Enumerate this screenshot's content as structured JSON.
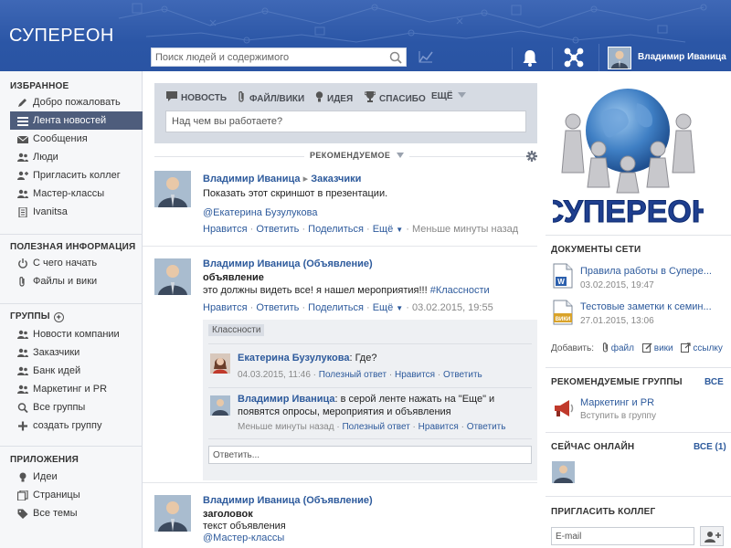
{
  "header": {
    "logo": "СУПЕРЕОН",
    "search_placeholder": "Поиск людей и содержимого",
    "user_name": "Владимир Иваница"
  },
  "sidebar": {
    "favorites_title": "ИЗБРАННОЕ",
    "favorites": [
      {
        "label": "Добро пожаловать",
        "icon": "pencil-icon"
      },
      {
        "label": "Лента новостей",
        "icon": "list-icon",
        "active": true
      },
      {
        "label": "Сообщения",
        "icon": "envelope-icon"
      },
      {
        "label": "Люди",
        "icon": "people-icon"
      },
      {
        "label": "Пригласить коллег",
        "icon": "add-user-icon"
      },
      {
        "label": "Мастер-классы",
        "icon": "people-icon"
      },
      {
        "label": "Ivanitsa",
        "icon": "page-icon"
      }
    ],
    "useful_title": "ПОЛЕЗНАЯ ИНФОРМАЦИЯ",
    "useful": [
      {
        "label": "С чего начать",
        "icon": "power-icon"
      },
      {
        "label": "Файлы и вики",
        "icon": "paperclip-icon"
      }
    ],
    "groups_title": "ГРУППЫ",
    "groups": [
      {
        "label": "Новости компании",
        "icon": "people-icon"
      },
      {
        "label": "Заказчики",
        "icon": "people-icon"
      },
      {
        "label": "Банк идей",
        "icon": "people-icon"
      },
      {
        "label": "Маркетинг и PR",
        "icon": "people-icon"
      },
      {
        "label": "Все группы",
        "icon": "search-icon"
      },
      {
        "label": "создать группу",
        "icon": "plus-icon"
      }
    ],
    "apps_title": "ПРИЛОЖЕНИЯ",
    "apps": [
      {
        "label": "Идеи",
        "icon": "bulb-icon"
      },
      {
        "label": "Страницы",
        "icon": "pages-icon"
      },
      {
        "label": "Все темы",
        "icon": "tag-icon"
      }
    ]
  },
  "composer": {
    "tabs": [
      "НОВОСТЬ",
      "ФАЙЛ/ВИКИ",
      "ИДЕЯ",
      "СПАСИБО",
      "ЕЩЁ"
    ],
    "placeholder": "Над чем вы работаете?"
  },
  "feed": {
    "filter_label": "РЕКОМЕНДУЕМОЕ",
    "post1": {
      "author": "Владимир Иваница",
      "target": "Заказчики",
      "text": "Показать этот скриншот в презентации.",
      "mention": "@Екатерина Бузулукова",
      "like": "Нравится",
      "reply": "Ответить",
      "share": "Поделиться",
      "more": "Ещё",
      "time": "Меньше минуты назад"
    },
    "post2": {
      "author": "Владимир Иваница (Объявление)",
      "title": "объявление",
      "text": "это должны видеть все! я нашел мероприятия!!! ",
      "hashtag": "#Классности",
      "like": "Нравится",
      "reply": "Ответить",
      "share": "Поделиться",
      "more": "Ещё",
      "time": "03.02.2015, 19:55",
      "topic_tag": "Классности",
      "comments": [
        {
          "author": "Екатерина Бузулукова",
          "text": "Где?",
          "time": "04.03.2015, 11:46",
          "useful": "Полезный ответ",
          "like": "Нравится",
          "reply": "Ответить"
        },
        {
          "author": "Владимир Иваница",
          "text": "в серой ленте нажать на \"Еще\" и",
          "text2": "появятся опросы, мероприятия и объявления",
          "time": "Меньше минуты назад",
          "useful": "Полезный ответ",
          "like": "Нравится",
          "reply": "Ответить"
        }
      ],
      "reply_placeholder": "Ответить..."
    },
    "post3": {
      "author": "Владимир Иваница (Объявление)",
      "title": "заголовок",
      "text": "текст объявления",
      "mention": "@Мастер-классы"
    }
  },
  "right": {
    "logo_text": "СУПЕРЕОН",
    "docs_title": "ДОКУМЕНТЫ СЕТИ",
    "docs": [
      {
        "title": "Правила работы в Супере...",
        "date": "03.02.2015, 19:47",
        "icon": "word-doc-icon",
        "badge": "W"
      },
      {
        "title": "Тестовые заметки к семин...",
        "date": "27.01.2015, 13:06",
        "icon": "wiki-doc-icon",
        "badge": "ВИКИ"
      }
    ],
    "add_label": "Добавить:",
    "add_file": "файл",
    "add_wiki": "вики",
    "add_link": "ссылку",
    "groups_title": "РЕКОМЕНДУЕМЫЕ ГРУППЫ",
    "groups_all": "ВСЕ",
    "group_name": "Маркетинг и PR",
    "group_join": "Вступить в группу",
    "online_title": "СЕЙЧАС ОНЛАЙН",
    "online_all": "ВСЕ (1)",
    "invite_title": "ПРИГЛАСИТЬ КОЛЛЕГ",
    "email_placeholder": "E-mail"
  },
  "colors": {
    "header_blue": "#2b56a6",
    "link_blue": "#2d5a9c",
    "active_nav": "#4e5d7c"
  }
}
